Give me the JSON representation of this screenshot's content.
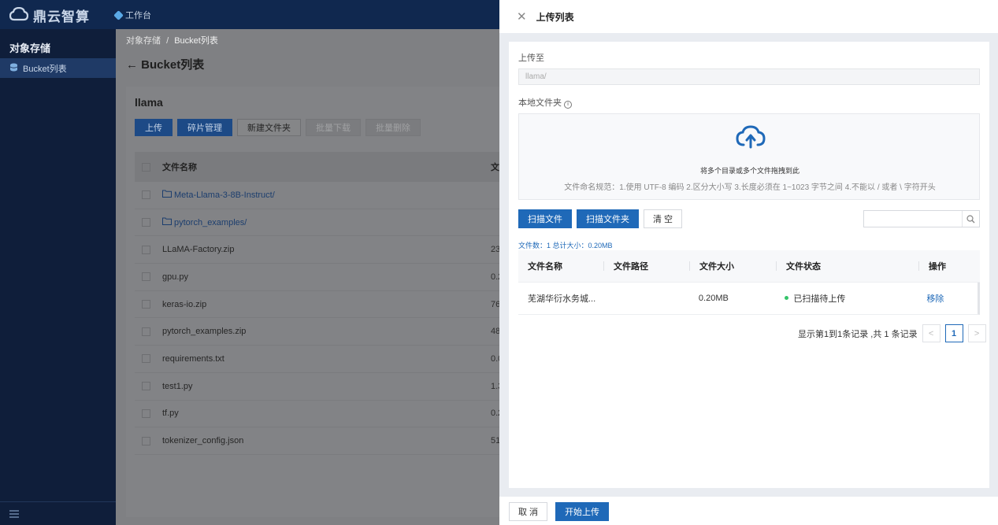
{
  "app": {
    "brand": "鼎云智算",
    "workbench": "工作台"
  },
  "sidebar": {
    "title": "对象存储",
    "items": [
      {
        "label": "Bucket列表"
      }
    ]
  },
  "breadcrumb": {
    "root": "对象存储",
    "separator": "/",
    "current": "Bucket列表"
  },
  "page": {
    "title": "Bucket列表"
  },
  "bucket": {
    "name": "llama",
    "buttons": {
      "upload": "上传",
      "fragments": "碎片管理",
      "new_folder": "新建文件夹",
      "batch_download": "批量下载",
      "batch_delete": "批量删除"
    },
    "table": {
      "header": {
        "name": "文件名称",
        "size": "文"
      },
      "rows": [
        {
          "name": "Meta-Llama-3-8B-Instruct/",
          "size": "",
          "type": "folder"
        },
        {
          "name": "pytorch_examples/",
          "size": "",
          "type": "folder"
        },
        {
          "name": "LLaMA-Factory.zip",
          "size": "23",
          "type": "file"
        },
        {
          "name": "gpu.py",
          "size": "0.2",
          "type": "file"
        },
        {
          "name": "keras-io.zip",
          "size": "76",
          "type": "file"
        },
        {
          "name": "pytorch_examples.zip",
          "size": "48",
          "type": "file"
        },
        {
          "name": "requirements.txt",
          "size": "0.0",
          "type": "file"
        },
        {
          "name": "test1.py",
          "size": "1.3",
          "type": "file"
        },
        {
          "name": "tf.py",
          "size": "0.2",
          "type": "file"
        },
        {
          "name": "tokenizer_config.json",
          "size": "51",
          "type": "file"
        }
      ]
    }
  },
  "drawer": {
    "title": "上传列表",
    "upload_to_label": "上传至",
    "upload_to_value": "llama/",
    "local_folder_label": "本地文件夹",
    "dropzone": {
      "main": "将多个目录或多个文件拖拽到此",
      "rules": "文件命名规范：1.使用 UTF-8 编码 2.区分大小写 3.长度必须在 1~1023 字节之间 4.不能以 / 或者 \\ 字符开头"
    },
    "actions": {
      "scan_files": "扫描文件",
      "scan_folder": "扫描文件夹",
      "clear": "清 空"
    },
    "summary": "文件数：1 总计大小：0.20MB",
    "table": {
      "headers": {
        "name": "文件名称",
        "path": "文件路径",
        "size": "文件大小",
        "status": "文件状态",
        "action": "操作"
      },
      "rows": [
        {
          "name": "芜湖华衍水务城...",
          "path": "",
          "size": "0.20MB",
          "status": "已扫描待上传",
          "action": "移除"
        }
      ]
    },
    "pagination": {
      "info": "显示第1到1条记录 ,共 1 条记录",
      "current_page": "1",
      "prev": "<",
      "next": ">"
    },
    "footer": {
      "cancel": "取 消",
      "start": "开始上传"
    }
  },
  "colors": {
    "primary": "#1f69b8",
    "status_green": "#35c46a"
  }
}
